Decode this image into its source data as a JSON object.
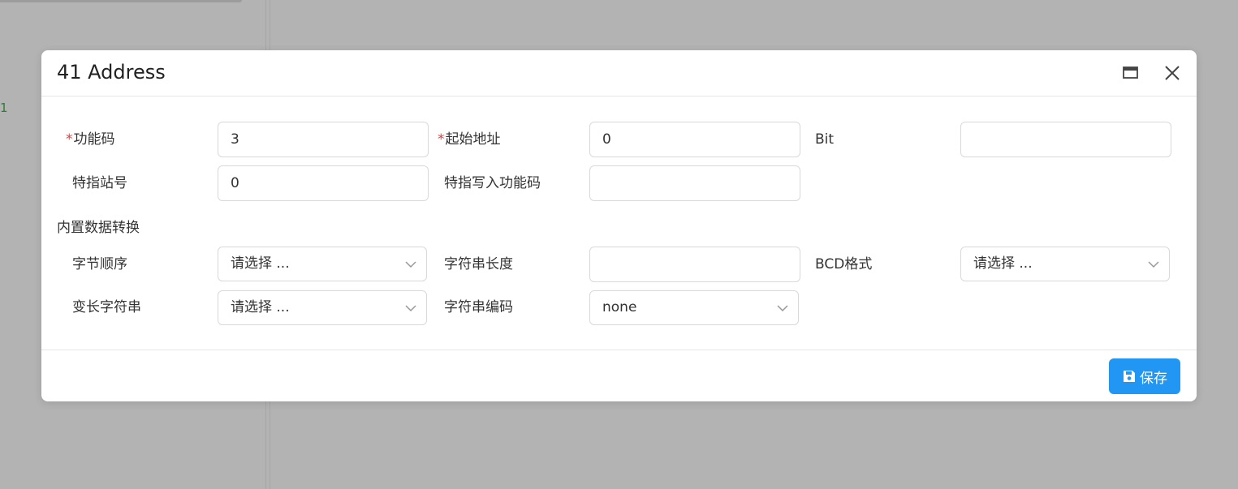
{
  "background": {
    "edge_number": "1"
  },
  "dialog": {
    "title": "41 Address",
    "maximize_icon": "window-maximize-icon",
    "close_icon": "close-icon"
  },
  "form": {
    "function_code": {
      "label": "功能码",
      "value": "3",
      "required": true
    },
    "start_address": {
      "label": "起始地址",
      "value": "0",
      "required": true
    },
    "bit": {
      "label": "Bit",
      "value": ""
    },
    "station_no": {
      "label": "特指站号",
      "value": "0"
    },
    "write_function_code": {
      "label": "特指写入功能码",
      "value": ""
    },
    "section_title": "内置数据转换",
    "byte_order": {
      "label": "字节顺序",
      "value": "请选择 ..."
    },
    "string_length": {
      "label": "字符串长度",
      "value": ""
    },
    "bcd_format": {
      "label": "BCD格式",
      "value": "请选择 ..."
    },
    "variable_string": {
      "label": "变长字符串",
      "value": "请选择 ..."
    },
    "string_encoding": {
      "label": "字符串编码",
      "value": "none"
    }
  },
  "footer": {
    "save_label": "保存",
    "save_icon": "floppy-disk-icon",
    "accent": "#2196f3"
  }
}
